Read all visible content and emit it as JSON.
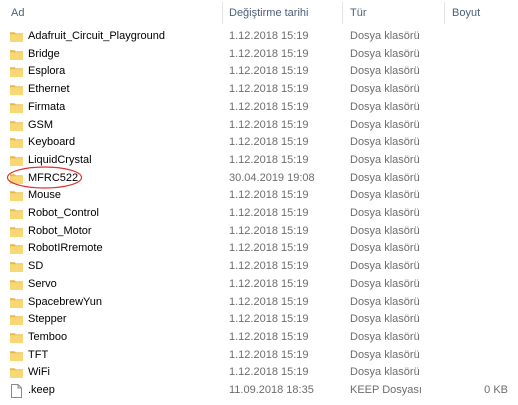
{
  "columns": {
    "name": "Ad",
    "date": "Değiştirme tarihi",
    "type": "Tür",
    "size": "Boyut"
  },
  "colors": {
    "folder_body": "#f8d775",
    "folder_tab": "#e6b84a",
    "highlight": "#e03030",
    "header_text": "#4c607a"
  },
  "files": [
    {
      "name": "Adafruit_Circuit_Playground",
      "date": "1.12.2018 15:19",
      "type": "Dosya klasörü",
      "size": "",
      "icon": "folder-icon"
    },
    {
      "name": "Bridge",
      "date": "1.12.2018 15:19",
      "type": "Dosya klasörü",
      "size": "",
      "icon": "folder-icon"
    },
    {
      "name": "Esplora",
      "date": "1.12.2018 15:19",
      "type": "Dosya klasörü",
      "size": "",
      "icon": "folder-icon"
    },
    {
      "name": "Ethernet",
      "date": "1.12.2018 15:19",
      "type": "Dosya klasörü",
      "size": "",
      "icon": "folder-icon"
    },
    {
      "name": "Firmata",
      "date": "1.12.2018 15:19",
      "type": "Dosya klasörü",
      "size": "",
      "icon": "folder-icon"
    },
    {
      "name": "GSM",
      "date": "1.12.2018 15:19",
      "type": "Dosya klasörü",
      "size": "",
      "icon": "folder-icon"
    },
    {
      "name": "Keyboard",
      "date": "1.12.2018 15:19",
      "type": "Dosya klasörü",
      "size": "",
      "icon": "folder-icon"
    },
    {
      "name": "LiquidCrystal",
      "date": "1.12.2018 15:19",
      "type": "Dosya klasörü",
      "size": "",
      "icon": "folder-icon"
    },
    {
      "name": "MFRC522",
      "date": "30.04.2019 19:08",
      "type": "Dosya klasörü",
      "size": "",
      "icon": "folder-icon"
    },
    {
      "name": "Mouse",
      "date": "1.12.2018 15:19",
      "type": "Dosya klasörü",
      "size": "",
      "icon": "folder-icon"
    },
    {
      "name": "Robot_Control",
      "date": "1.12.2018 15:19",
      "type": "Dosya klasörü",
      "size": "",
      "icon": "folder-icon"
    },
    {
      "name": "Robot_Motor",
      "date": "1.12.2018 15:19",
      "type": "Dosya klasörü",
      "size": "",
      "icon": "folder-icon"
    },
    {
      "name": "RobotIRremote",
      "date": "1.12.2018 15:19",
      "type": "Dosya klasörü",
      "size": "",
      "icon": "folder-icon"
    },
    {
      "name": "SD",
      "date": "1.12.2018 15:19",
      "type": "Dosya klasörü",
      "size": "",
      "icon": "folder-icon"
    },
    {
      "name": "Servo",
      "date": "1.12.2018 15:19",
      "type": "Dosya klasörü",
      "size": "",
      "icon": "folder-icon"
    },
    {
      "name": "SpacebrewYun",
      "date": "1.12.2018 15:19",
      "type": "Dosya klasörü",
      "size": "",
      "icon": "folder-icon"
    },
    {
      "name": "Stepper",
      "date": "1.12.2018 15:19",
      "type": "Dosya klasörü",
      "size": "",
      "icon": "folder-icon"
    },
    {
      "name": "Temboo",
      "date": "1.12.2018 15:19",
      "type": "Dosya klasörü",
      "size": "",
      "icon": "folder-icon"
    },
    {
      "name": "TFT",
      "date": "1.12.2018 15:19",
      "type": "Dosya klasörü",
      "size": "",
      "icon": "folder-icon"
    },
    {
      "name": "WiFi",
      "date": "1.12.2018 15:19",
      "type": "Dosya klasörü",
      "size": "",
      "icon": "folder-icon"
    },
    {
      "name": ".keep",
      "date": "11.09.2018 18:35",
      "type": "KEEP Dosyası",
      "size": "0 KB",
      "icon": "file-icon"
    }
  ]
}
